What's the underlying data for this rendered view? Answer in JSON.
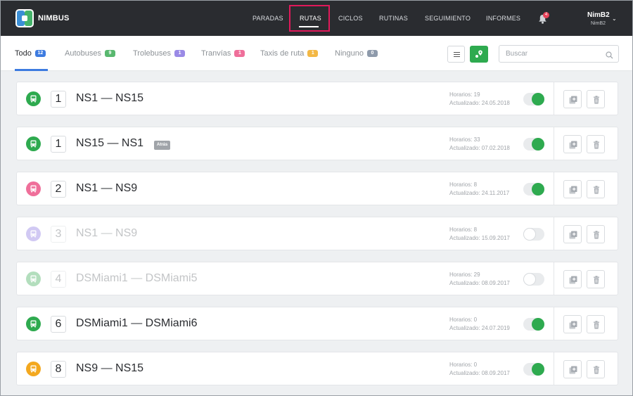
{
  "brand": {
    "name": "NIMBUS"
  },
  "nav": {
    "items": [
      "PARADAS",
      "RUTAS",
      "CICLOS",
      "RUTINAS",
      "SEGUIMIENTO",
      "INFORMES"
    ],
    "active": "RUTAS",
    "notifications": "4",
    "user_name": "NimB2",
    "user_sub": "NimB2"
  },
  "filters": {
    "tabs": [
      {
        "label": "Todo",
        "count": "12",
        "color": "#3d7be0"
      },
      {
        "label": "Autobuses",
        "count": "9",
        "color": "#59b86f"
      },
      {
        "label": "Trolebuses",
        "count": "1",
        "color": "#9a8ae6"
      },
      {
        "label": "Tranvías",
        "count": "1",
        "color": "#ef6f9a"
      },
      {
        "label": "Taxis de ruta",
        "count": "1",
        "color": "#f3b845"
      },
      {
        "label": "Ninguno",
        "count": "0",
        "color": "#8e9aab"
      }
    ],
    "search_placeholder": "Buscar"
  },
  "routes": [
    {
      "number": "1",
      "name": "NS1 — NS15",
      "tag": "",
      "horarios": "Horarios: 19",
      "actualizado": "Actualizado: 24.05.2018",
      "enabled": true,
      "type_color": "#2eaa4f"
    },
    {
      "number": "1",
      "name": "NS15 — NS1",
      "tag": "Atrás",
      "horarios": "Horarios: 33",
      "actualizado": "Actualizado: 07.02.2018",
      "enabled": true,
      "type_color": "#2eaa4f"
    },
    {
      "number": "2",
      "name": "NS1 — NS9",
      "tag": "",
      "horarios": "Horarios: 8",
      "actualizado": "Actualizado: 24.11.2017",
      "enabled": true,
      "type_color": "#ef6f9a"
    },
    {
      "number": "3",
      "name": "NS1 — NS9",
      "tag": "",
      "horarios": "Horarios: 8",
      "actualizado": "Actualizado: 15.09.2017",
      "enabled": false,
      "type_color": "#9a8ae6"
    },
    {
      "number": "4",
      "name": "DSMiami1 — DSMiami5",
      "tag": "",
      "horarios": "Horarios: 29",
      "actualizado": "Actualizado: 08.09.2017",
      "enabled": false,
      "type_color": "#59b86f"
    },
    {
      "number": "6",
      "name": "DSMiami1 — DSMiami6",
      "tag": "",
      "horarios": "Horarios: 0",
      "actualizado": "Actualizado: 24.07.2019",
      "enabled": true,
      "type_color": "#2eaa4f"
    },
    {
      "number": "8",
      "name": "NS9 — NS15",
      "tag": "",
      "horarios": "Horarios: 0",
      "actualizado": "Actualizado: 08.09.2017",
      "enabled": true,
      "type_color": "#f3a81f"
    }
  ]
}
